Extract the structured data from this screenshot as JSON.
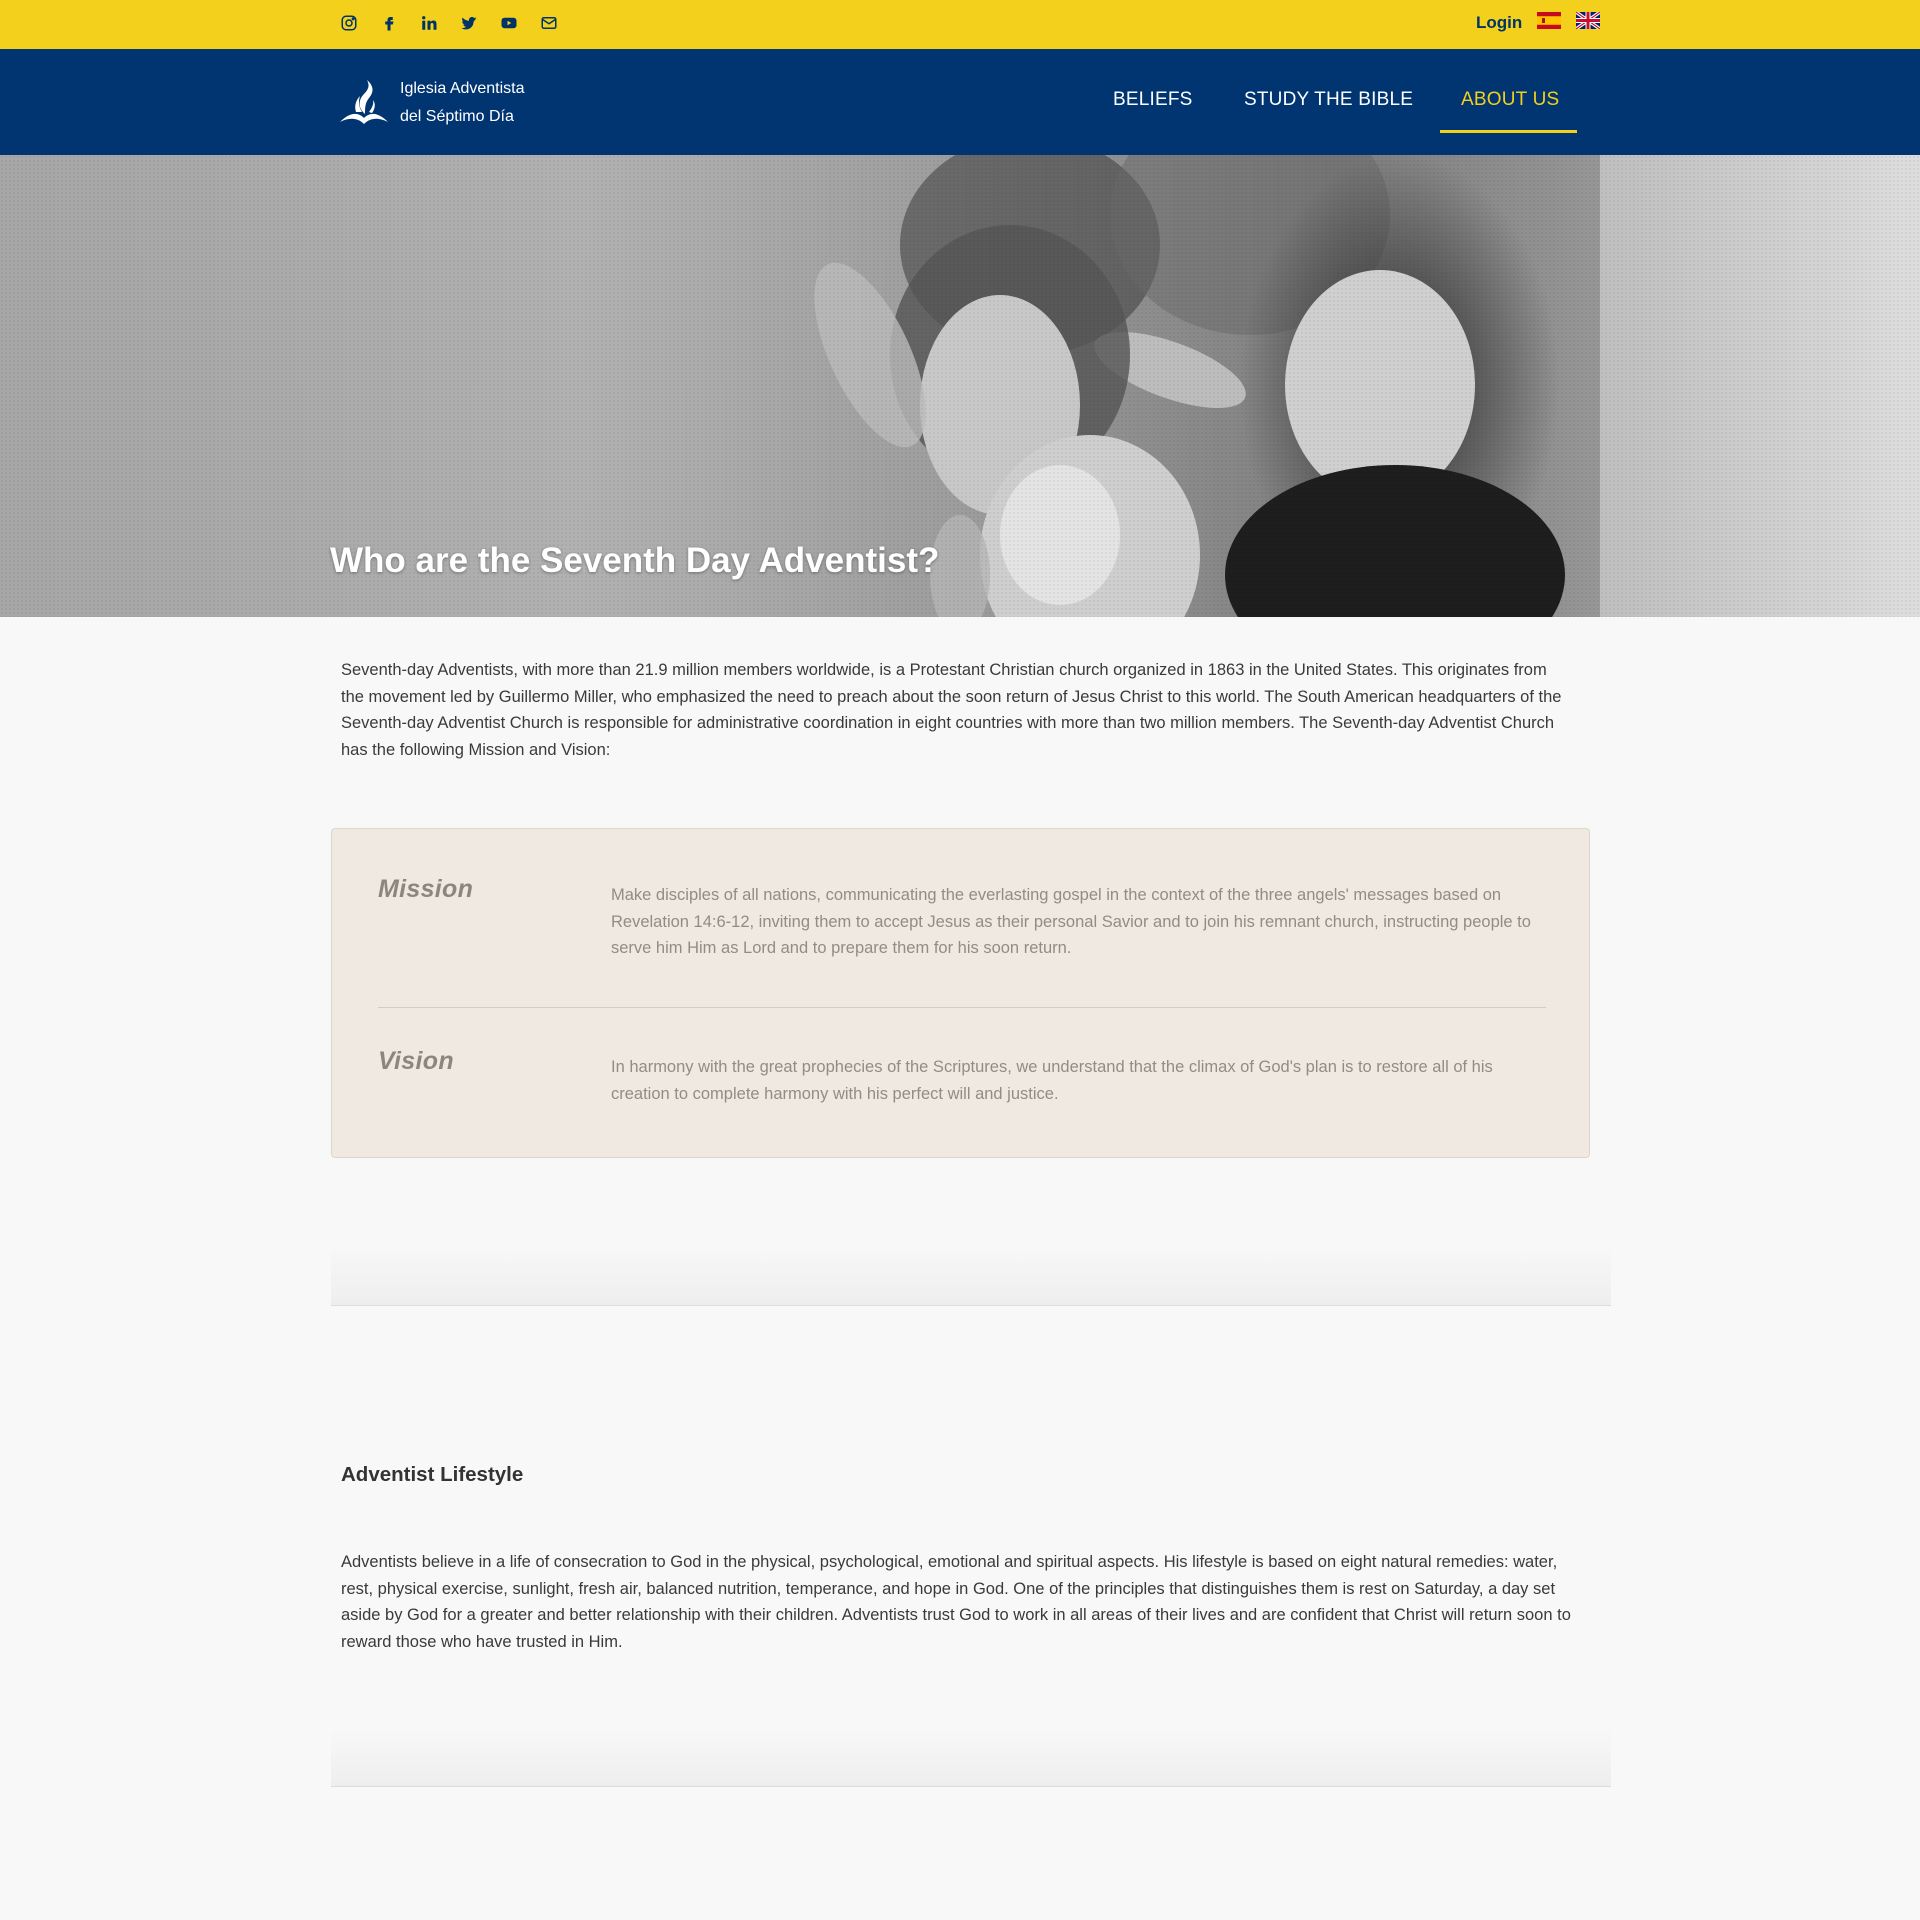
{
  "colors": {
    "topbar": "#f2d01b",
    "navbar": "#003572",
    "accent": "#f2d01b",
    "mv_background": "#efe9e2",
    "mv_text": "#938c84",
    "mv_heading": "#8c867e"
  },
  "topbar": {
    "social_icons": [
      "instagram-icon",
      "facebook-icon",
      "linkedin-icon",
      "twitter-icon",
      "youtube-icon",
      "email-icon"
    ],
    "login_label": "Login",
    "languages": [
      "spanish-flag",
      "english-flag"
    ]
  },
  "header": {
    "logo_line1": "Iglesia Adventista",
    "logo_line2": "del Séptimo Día",
    "nav": {
      "beliefs": "BELIEFS",
      "study": "STUDY THE BIBLE",
      "about": "ABOUT US"
    },
    "active_nav": "ABOUT US"
  },
  "hero": {
    "title": "Who are the Seventh Day Adventist?"
  },
  "intro": {
    "text": "Seventh-day Adventists, with more than 21.9 million members worldwide, is a Protestant Christian church organized in 1863 in the United States. This originates from the movement led by Guillermo Miller, who emphasized the need to preach about the soon return of Jesus Christ to this world. The South American headquarters of the Seventh-day Adventist Church is responsible for administrative coordination in eight countries with more than two million members. The Seventh-day Adventist Church has the following Mission and Vision:"
  },
  "mission": {
    "title": "Mission",
    "text": "Make disciples of all nations, communicating the everlasting gospel in the context of the three angels' messages based on Revelation 14:6-12, inviting them to accept Jesus as their personal Savior and to join his remnant church, instructing people to serve him Him as Lord and to prepare them for his soon return."
  },
  "vision": {
    "title": "Vision",
    "text": "In harmony with the great prophecies of the Scriptures, we understand that the climax of God's plan is to restore all of his creation to complete harmony with his perfect will and justice."
  },
  "lifestyle": {
    "title": "Adventist Lifestyle",
    "text": "Adventists believe in a life of consecration to God in the physical, psychological, emotional and spiritual aspects. His lifestyle is based on eight natural remedies: water, rest, physical exercise, sunlight, fresh air, balanced nutrition, temperance, and hope in God. One of the principles that distinguishes them is rest on Saturday, a day set aside by God for a greater and better relationship with their children. Adventists trust God to work in all areas of their lives and are confident that Christ will return soon to reward those who have trusted in Him."
  }
}
